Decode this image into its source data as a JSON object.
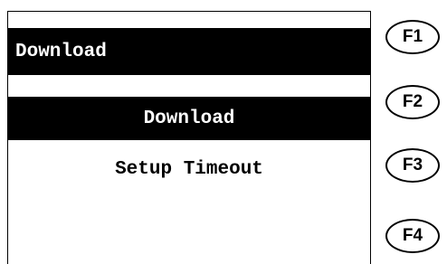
{
  "screen": {
    "title": "Download",
    "menu": [
      {
        "label": "Download",
        "selected": true
      },
      {
        "label": "Setup Timeout",
        "selected": false
      }
    ]
  },
  "function_keys": [
    "F1",
    "F2",
    "F3",
    "F4"
  ]
}
